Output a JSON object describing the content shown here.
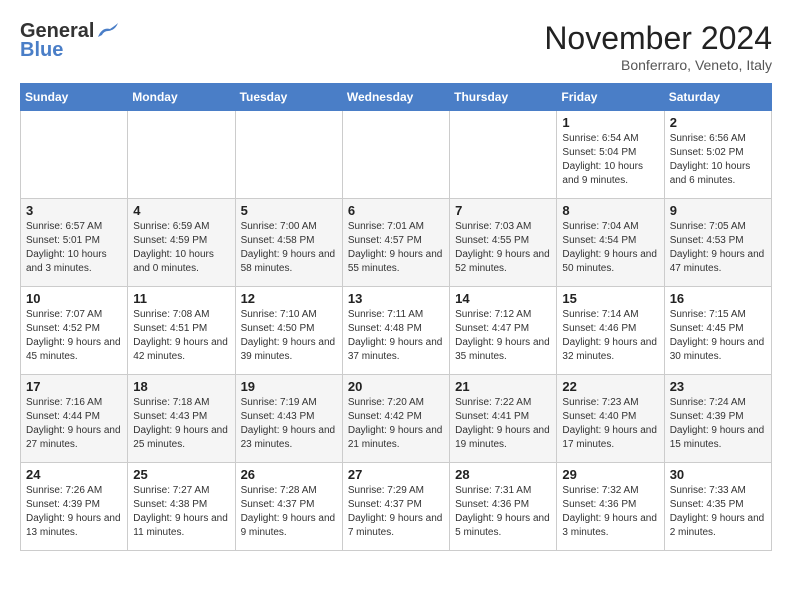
{
  "header": {
    "logo_general": "General",
    "logo_blue": "Blue",
    "month_year": "November 2024",
    "location": "Bonferraro, Veneto, Italy"
  },
  "days_of_week": [
    "Sunday",
    "Monday",
    "Tuesday",
    "Wednesday",
    "Thursday",
    "Friday",
    "Saturday"
  ],
  "weeks": [
    [
      {
        "day": "",
        "info": ""
      },
      {
        "day": "",
        "info": ""
      },
      {
        "day": "",
        "info": ""
      },
      {
        "day": "",
        "info": ""
      },
      {
        "day": "",
        "info": ""
      },
      {
        "day": "1",
        "info": "Sunrise: 6:54 AM\nSunset: 5:04 PM\nDaylight: 10 hours and 9 minutes."
      },
      {
        "day": "2",
        "info": "Sunrise: 6:56 AM\nSunset: 5:02 PM\nDaylight: 10 hours and 6 minutes."
      }
    ],
    [
      {
        "day": "3",
        "info": "Sunrise: 6:57 AM\nSunset: 5:01 PM\nDaylight: 10 hours and 3 minutes."
      },
      {
        "day": "4",
        "info": "Sunrise: 6:59 AM\nSunset: 4:59 PM\nDaylight: 10 hours and 0 minutes."
      },
      {
        "day": "5",
        "info": "Sunrise: 7:00 AM\nSunset: 4:58 PM\nDaylight: 9 hours and 58 minutes."
      },
      {
        "day": "6",
        "info": "Sunrise: 7:01 AM\nSunset: 4:57 PM\nDaylight: 9 hours and 55 minutes."
      },
      {
        "day": "7",
        "info": "Sunrise: 7:03 AM\nSunset: 4:55 PM\nDaylight: 9 hours and 52 minutes."
      },
      {
        "day": "8",
        "info": "Sunrise: 7:04 AM\nSunset: 4:54 PM\nDaylight: 9 hours and 50 minutes."
      },
      {
        "day": "9",
        "info": "Sunrise: 7:05 AM\nSunset: 4:53 PM\nDaylight: 9 hours and 47 minutes."
      }
    ],
    [
      {
        "day": "10",
        "info": "Sunrise: 7:07 AM\nSunset: 4:52 PM\nDaylight: 9 hours and 45 minutes."
      },
      {
        "day": "11",
        "info": "Sunrise: 7:08 AM\nSunset: 4:51 PM\nDaylight: 9 hours and 42 minutes."
      },
      {
        "day": "12",
        "info": "Sunrise: 7:10 AM\nSunset: 4:50 PM\nDaylight: 9 hours and 39 minutes."
      },
      {
        "day": "13",
        "info": "Sunrise: 7:11 AM\nSunset: 4:48 PM\nDaylight: 9 hours and 37 minutes."
      },
      {
        "day": "14",
        "info": "Sunrise: 7:12 AM\nSunset: 4:47 PM\nDaylight: 9 hours and 35 minutes."
      },
      {
        "day": "15",
        "info": "Sunrise: 7:14 AM\nSunset: 4:46 PM\nDaylight: 9 hours and 32 minutes."
      },
      {
        "day": "16",
        "info": "Sunrise: 7:15 AM\nSunset: 4:45 PM\nDaylight: 9 hours and 30 minutes."
      }
    ],
    [
      {
        "day": "17",
        "info": "Sunrise: 7:16 AM\nSunset: 4:44 PM\nDaylight: 9 hours and 27 minutes."
      },
      {
        "day": "18",
        "info": "Sunrise: 7:18 AM\nSunset: 4:43 PM\nDaylight: 9 hours and 25 minutes."
      },
      {
        "day": "19",
        "info": "Sunrise: 7:19 AM\nSunset: 4:43 PM\nDaylight: 9 hours and 23 minutes."
      },
      {
        "day": "20",
        "info": "Sunrise: 7:20 AM\nSunset: 4:42 PM\nDaylight: 9 hours and 21 minutes."
      },
      {
        "day": "21",
        "info": "Sunrise: 7:22 AM\nSunset: 4:41 PM\nDaylight: 9 hours and 19 minutes."
      },
      {
        "day": "22",
        "info": "Sunrise: 7:23 AM\nSunset: 4:40 PM\nDaylight: 9 hours and 17 minutes."
      },
      {
        "day": "23",
        "info": "Sunrise: 7:24 AM\nSunset: 4:39 PM\nDaylight: 9 hours and 15 minutes."
      }
    ],
    [
      {
        "day": "24",
        "info": "Sunrise: 7:26 AM\nSunset: 4:39 PM\nDaylight: 9 hours and 13 minutes."
      },
      {
        "day": "25",
        "info": "Sunrise: 7:27 AM\nSunset: 4:38 PM\nDaylight: 9 hours and 11 minutes."
      },
      {
        "day": "26",
        "info": "Sunrise: 7:28 AM\nSunset: 4:37 PM\nDaylight: 9 hours and 9 minutes."
      },
      {
        "day": "27",
        "info": "Sunrise: 7:29 AM\nSunset: 4:37 PM\nDaylight: 9 hours and 7 minutes."
      },
      {
        "day": "28",
        "info": "Sunrise: 7:31 AM\nSunset: 4:36 PM\nDaylight: 9 hours and 5 minutes."
      },
      {
        "day": "29",
        "info": "Sunrise: 7:32 AM\nSunset: 4:36 PM\nDaylight: 9 hours and 3 minutes."
      },
      {
        "day": "30",
        "info": "Sunrise: 7:33 AM\nSunset: 4:35 PM\nDaylight: 9 hours and 2 minutes."
      }
    ]
  ]
}
